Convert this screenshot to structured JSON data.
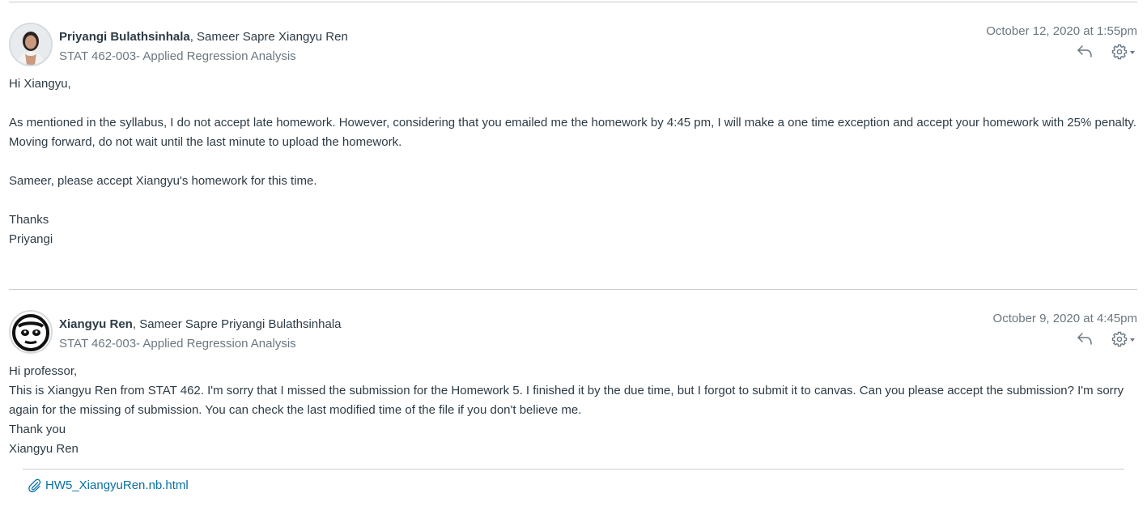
{
  "messages": [
    {
      "author": "Priyangi Bulathsinhala",
      "other_participants": ", Sameer Sapre Xiangyu Ren",
      "course": "STAT 462-003- Applied Regression Analysis",
      "date": "October 12, 2020 at 1:55pm",
      "body": [
        "Hi Xiangyu,",
        "",
        "As mentioned in the syllabus, I do not accept late homework. However, considering that you emailed me the homework by 4:45 pm, I will make a one time exception and accept your homework with 25% penalty.",
        "Moving forward, do not wait until the last minute to upload the homework.",
        "",
        "Sameer, please accept Xiangyu's homework for this time.",
        "",
        "Thanks",
        "Priyangi"
      ]
    },
    {
      "author": "Xiangyu Ren",
      "other_participants": ", Sameer Sapre Priyangi Bulathsinhala",
      "course": "STAT 462-003- Applied Regression Analysis",
      "date": "October 9, 2020 at 4:45pm",
      "body": [
        "Hi professor,",
        "This is Xiangyu Ren from STAT 462. I'm sorry that I missed the submission for the Homework 5. I finished it by the due time, but I forgot to submit it to canvas. Can you please accept the submission? I'm sorry again for the missing of submission. You can check the last modified time of the file if you don't believe me.",
        "Thank you",
        "Xiangyu Ren"
      ],
      "attachment": "HW5_XiangyuRen.nb.html"
    }
  ],
  "icons": {
    "reply": "reply-arrow-icon",
    "settings": "gear-icon",
    "dropdown": "caret-down-icon",
    "attachment": "paperclip-icon"
  },
  "colors": {
    "text": "#2d3b45",
    "muted": "#6b7780",
    "link": "#0770a3",
    "divider": "#c7cdd1"
  }
}
